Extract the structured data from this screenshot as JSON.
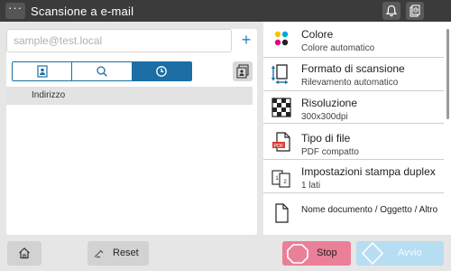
{
  "header": {
    "menu_label": "···",
    "title": "Scansione  a  e-mail",
    "icons": [
      "bell-icon",
      "job-list-icon"
    ]
  },
  "address": {
    "placeholder": "sample@test.local",
    "value": "",
    "add_label": "+"
  },
  "tabs": [
    {
      "icon": "address-book-icon",
      "active": false
    },
    {
      "icon": "search-icon",
      "active": false
    },
    {
      "icon": "clock-icon",
      "active": true
    }
  ],
  "list": {
    "column_header": "Indirizzo"
  },
  "settings": [
    {
      "label": "Colore",
      "value": "Colore  automatico",
      "icon": "color-icon"
    },
    {
      "label": "Formato  di  scansione",
      "value": "Rilevamento  automatico",
      "icon": "scan-size-icon"
    },
    {
      "label": "Risoluzione",
      "value": "300x300dpi",
      "icon": "resolution-icon"
    },
    {
      "label": "Tipo  di  file",
      "value": "PDF  compatto",
      "icon": "pdf-file-icon"
    },
    {
      "label": "Impostazioni  stampa  duplex",
      "value": "1  lati",
      "icon": "duplex-icon"
    },
    {
      "label": "Nome  documento  /  Oggetto  /  Altro",
      "value": "",
      "icon": "document-icon"
    }
  ],
  "footer": {
    "reset_label": "Reset",
    "stop_label": "Stop",
    "start_label": "Avvio"
  },
  "colors": {
    "topbar": "#3b3b3b",
    "accent": "#1c6ea4",
    "stop": "#ea7f98",
    "start": "#b7ddf2"
  }
}
